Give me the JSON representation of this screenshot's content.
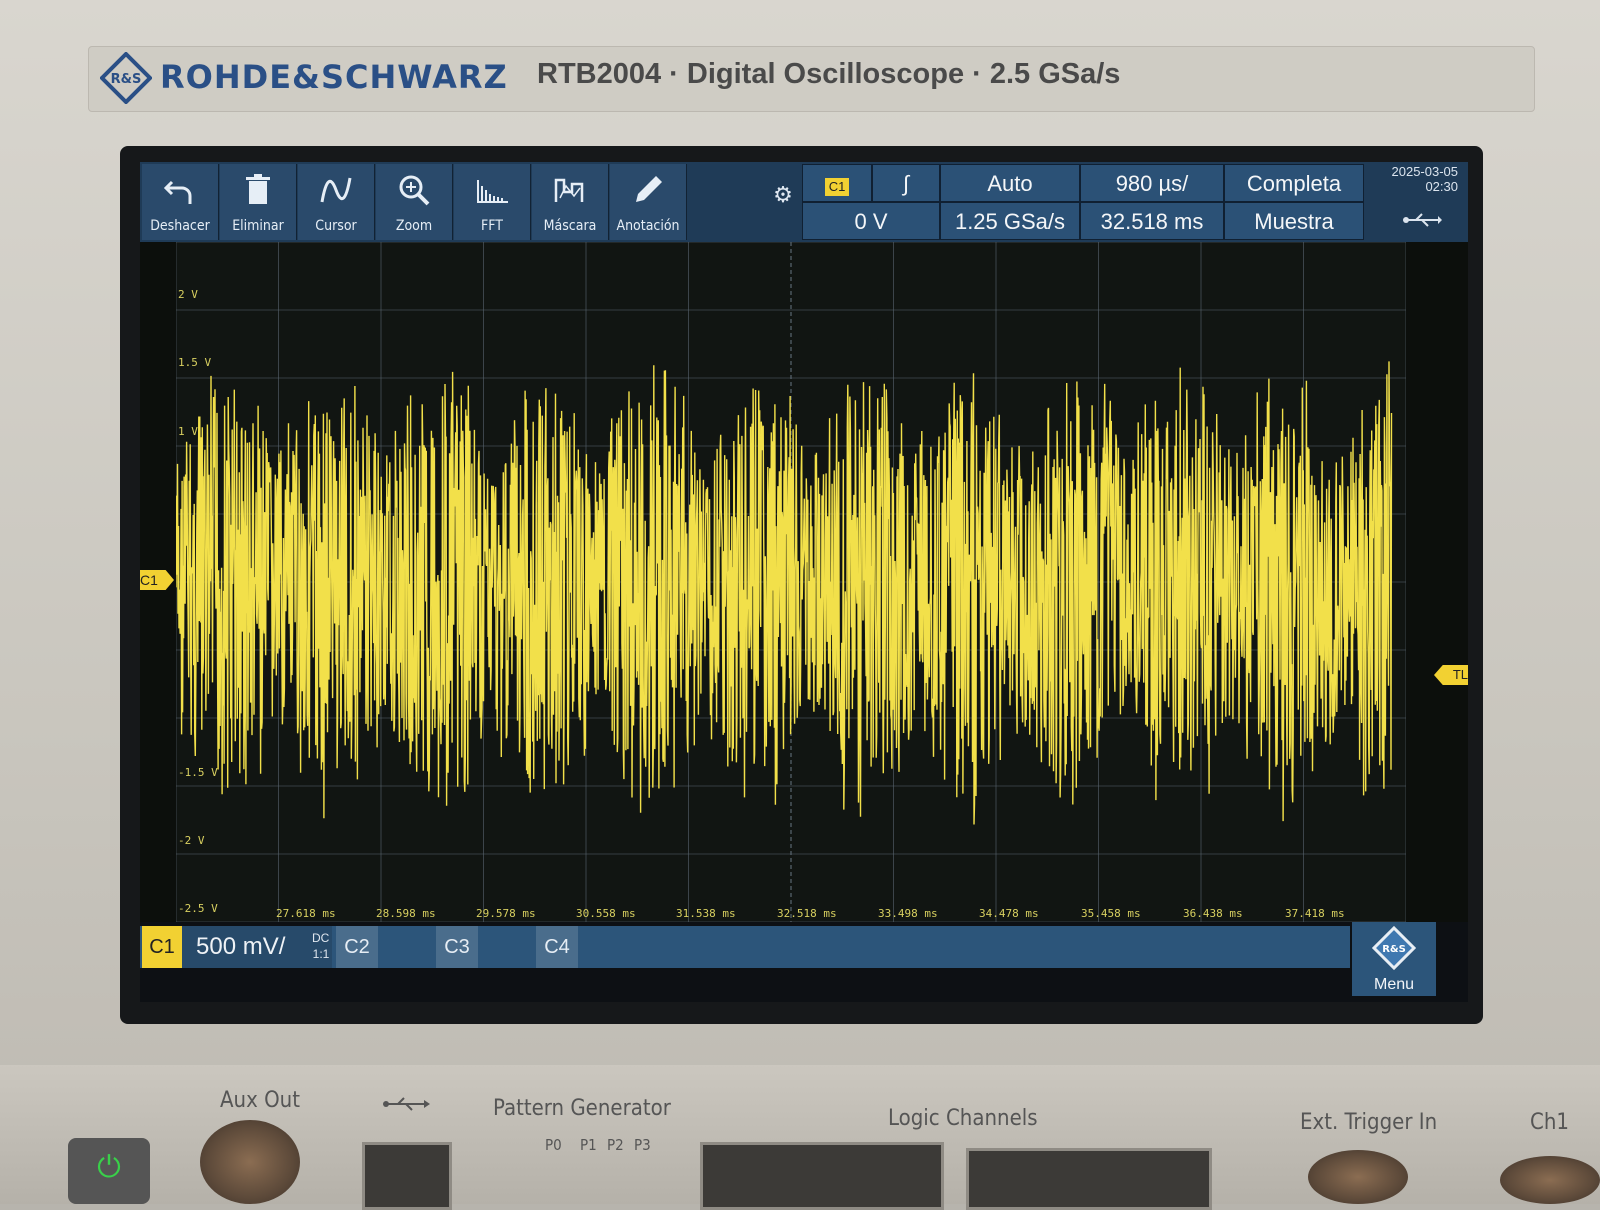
{
  "brand": {
    "name": "ROHDE&SCHWARZ",
    "model_line": "RTB2004 · Digital Oscilloscope · 2.5 GSa/s",
    "logo_text": "R&S"
  },
  "toolbar": {
    "tools": [
      {
        "label": "Deshacer",
        "icon": "undo-icon"
      },
      {
        "label": "Eliminar",
        "icon": "trash-icon"
      },
      {
        "label": "Cursor",
        "icon": "cursor-wave-icon"
      },
      {
        "label": "Zoom",
        "icon": "zoom-icon"
      },
      {
        "label": "FFT",
        "icon": "fft-icon"
      },
      {
        "label": "Máscara",
        "icon": "mask-icon"
      },
      {
        "label": "Anotación",
        "icon": "pencil-icon"
      }
    ],
    "settings_icon": "gear-icon"
  },
  "trigger": {
    "source": "C1",
    "slope_symbol": "∫",
    "level": "0 V",
    "mode": "Auto",
    "sample_rate": "1.25 GSa/s",
    "timebase": "980 µs/",
    "position": "32.518 ms",
    "acquisition": "Completa",
    "acq_mode": "Muestra"
  },
  "datetime": {
    "date": "2025-03-05",
    "time": "02:30"
  },
  "plot": {
    "y_labels": [
      "2 V",
      "1.5 V",
      "1 V",
      "-1.5 V",
      "-2 V",
      "-2.5 V"
    ],
    "x_labels": [
      "27.618 ms",
      "28.598 ms",
      "29.578 ms",
      "30.558 ms",
      "31.538 ms",
      "32.518 ms",
      "33.498 ms",
      "34.478 ms",
      "35.458 ms",
      "36.438 ms",
      "37.418 ms"
    ],
    "channel_marker": "C1",
    "trigger_level_marker": "TL",
    "trace_color": "#f2e04a",
    "grid_color": "#5a6670"
  },
  "channels": {
    "c1": {
      "label": "C1",
      "scale": "500 mV/",
      "coupling": "DC",
      "ratio": "1:1"
    },
    "c2": {
      "label": "C2"
    },
    "c3": {
      "label": "C3"
    },
    "c4": {
      "label": "C4"
    },
    "menu_label": "Menu"
  },
  "front_panel": {
    "aux_out": "Aux Out",
    "pattern_generator": "Pattern Generator",
    "pattern_pins": [
      "P0",
      "P1",
      "P2",
      "P3"
    ],
    "logic_channels": "Logic Channels",
    "ext_trigger": "Ext. Trigger In",
    "ch1": "Ch1"
  },
  "colors": {
    "accent_yellow": "#f2d132",
    "ui_blue": "#2b5176",
    "brand_blue": "#2a4f86"
  }
}
